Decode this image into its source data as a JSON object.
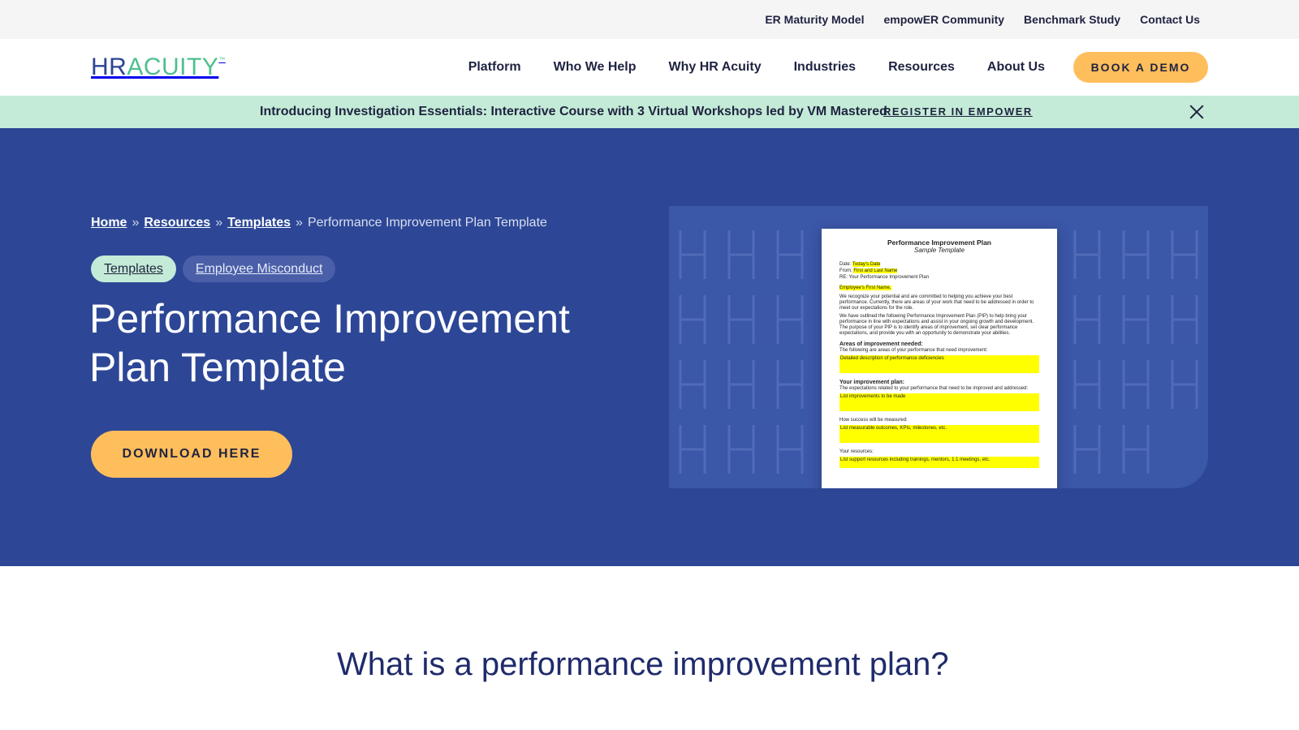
{
  "utility_nav": {
    "links": [
      "ER Maturity Model",
      "empowER Community",
      "Benchmark Study",
      "Contact Us"
    ]
  },
  "brand": {
    "logo_hr": "HR",
    "logo_acuity": "ACUITY",
    "logo_mark": "™",
    "colors": {
      "navy": "#2b4595",
      "green": "#4fbf8e",
      "orange": "#ffbe5c",
      "hero_bg": "#2d4796",
      "banner_bg": "#c4ebd7"
    }
  },
  "main_nav": {
    "items": [
      "Platform",
      "Who We Help",
      "Why HR Acuity",
      "Industries",
      "Resources",
      "About Us"
    ],
    "cta": "BOOK A DEMO"
  },
  "banner": {
    "text": "Introducing Investigation Essentials: Interactive Course with 3 Virtual Workshops led by VM Mastered",
    "link": "REGISTER IN EMPOWER",
    "close_icon": "close-icon"
  },
  "hero": {
    "breadcrumb": {
      "home": "Home",
      "resources": "Resources",
      "templates": "Templates",
      "separator": "»",
      "current": "Performance Improvement Plan Template"
    },
    "tags": [
      "Templates",
      "Employee Misconduct"
    ],
    "title": "Performance Improvement Plan Template",
    "cta": "DOWNLOAD HERE"
  },
  "document_preview": {
    "title": "Performance Improvement Plan",
    "subtitle": "Sample Template",
    "date_label": "Date:",
    "date_value": "Today's Date",
    "from_label": "From:",
    "from_value": "First and Last Name",
    "re_line": "RE: Your Performance Improvement Plan",
    "greeting": "Employee's First Name,",
    "para1": "We recognize your potential and are committed to helping you achieve your best performance. Currently, there are areas of your work that need to be addressed in order to meet our expectations for the role.",
    "para2": "We have outlined the following Performance Improvement Plan (PIP) to help bring your performance in line with expectations and assist in your ongoing growth and development. The purpose of your PIP is to identify areas of improvement, set clear performance expectations, and provide you with an opportunity to demonstrate your abilities.",
    "section1_head": "Areas of improvement needed:",
    "section1_sub": "The following are areas of your performance that need improvement:",
    "section1_box": "Detailed description of performance deficiencies",
    "section2_head": "Your improvement plan:",
    "section2_sub": "The expectations related to your performance that need to be improved and addressed:",
    "section2_box": "List improvements to be made",
    "section3_sub": "How success will be measured:",
    "section3_box": "List measurable outcomes, KPIs, milestones, etc.",
    "section4_sub": "Your resources:",
    "section4_box": "List support resources including trainings, mentors, 1:1 meetings, etc."
  },
  "content": {
    "section_title": "What is a performance improvement plan?"
  }
}
